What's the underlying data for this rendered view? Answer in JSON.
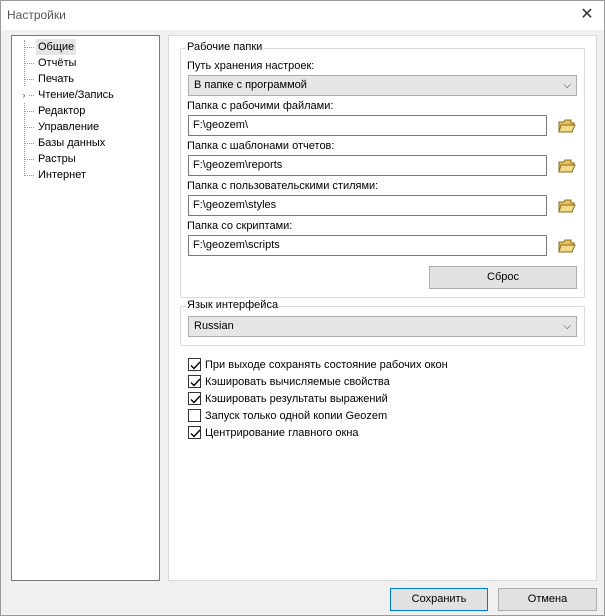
{
  "window": {
    "title": "Настройки"
  },
  "tree": {
    "items": [
      {
        "label": "Общие",
        "selected": true
      },
      {
        "label": "Отчёты"
      },
      {
        "label": "Печать"
      },
      {
        "label": "Чтение/Запись",
        "expandable": true
      },
      {
        "label": "Редактор"
      },
      {
        "label": "Управление"
      },
      {
        "label": "Базы данных"
      },
      {
        "label": "Растры"
      },
      {
        "label": "Интернет"
      }
    ]
  },
  "work_folders": {
    "title": "Рабочие папки",
    "settings_path_label": "Путь хранения настроек:",
    "settings_path_value": "В папке с программой",
    "work_files_label": "Папка с рабочими файлами:",
    "work_files_value": "F:\\geozem\\",
    "templates_label": "Папка с шаблонами отчетов:",
    "templates_value": "F:\\geozem\\reports",
    "styles_label": "Папка с пользовательскими стилями:",
    "styles_value": "F:\\geozem\\styles",
    "scripts_label": "Папка со скриптами:",
    "scripts_value": "F:\\geozem\\scripts",
    "reset_label": "Сброс"
  },
  "language": {
    "title": "Язык интерфейса",
    "value": "Russian"
  },
  "options": [
    {
      "label": "При выходе сохранять состояние рабочих окон",
      "checked": true
    },
    {
      "label": "Кэшировать вычисляемые свойства",
      "checked": true
    },
    {
      "label": "Кэшировать результаты выражений",
      "checked": true
    },
    {
      "label": "Запуск только одной копии Geozem",
      "checked": false
    },
    {
      "label": "Центрирование главного окна",
      "checked": true
    }
  ],
  "footer": {
    "save_label": "Сохранить",
    "cancel_label": "Отмена"
  },
  "colors": {
    "accent": "#0078d7",
    "folder_icon": "#e8c35a"
  }
}
